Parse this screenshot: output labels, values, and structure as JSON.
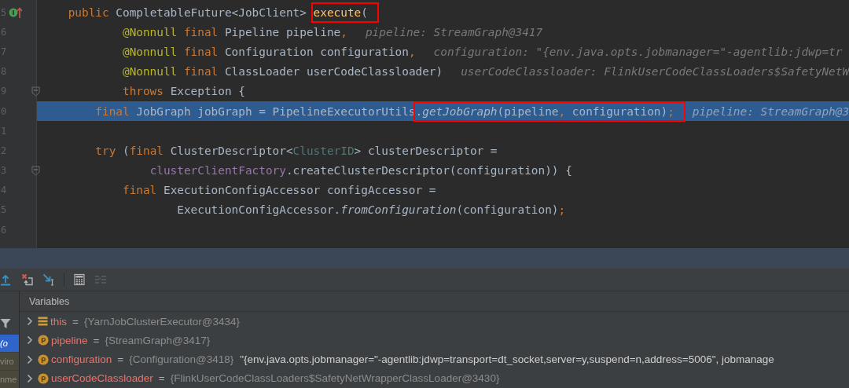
{
  "editor": {
    "lines": [
      {
        "number": "5",
        "override": true,
        "fold": false,
        "selected": false,
        "tokens": [
          {
            "kind": "keyword",
            "text": "    public"
          },
          {
            "kind": "plain",
            "text": " CompletableFuture<JobClient> "
          },
          {
            "kind": "frame",
            "tokens": [
              {
                "kind": "declaration",
                "text": "execute"
              },
              {
                "kind": "plain",
                "text": "("
              }
            ]
          }
        ]
      },
      {
        "number": "6",
        "override": false,
        "fold": false,
        "selected": false,
        "tokens": [
          {
            "kind": "annotation",
            "text": "            @Nonnull"
          },
          {
            "kind": "keyword",
            "text": " final"
          },
          {
            "kind": "plain",
            "text": " Pipeline pipeline"
          },
          {
            "kind": "punct",
            "text": ","
          }
        ],
        "hint": "pipeline: StreamGraph@3417"
      },
      {
        "number": "7",
        "override": false,
        "fold": false,
        "selected": false,
        "tokens": [
          {
            "kind": "annotation",
            "text": "            @Nonnull"
          },
          {
            "kind": "keyword",
            "text": " final"
          },
          {
            "kind": "plain",
            "text": " Configuration configuration"
          },
          {
            "kind": "punct",
            "text": ","
          }
        ],
        "hint": "configuration: \"{env.java.opts.jobmanager=\"-agentlib:jdwp=tr"
      },
      {
        "number": "8",
        "override": false,
        "fold": false,
        "selected": false,
        "tokens": [
          {
            "kind": "annotation",
            "text": "            @Nonnull"
          },
          {
            "kind": "keyword",
            "text": " final"
          },
          {
            "kind": "plain",
            "text": " ClassLoader userCodeClassloader)"
          }
        ],
        "hint": "userCodeClassloader: FlinkUserCodeClassLoaders$SafetyNetW"
      },
      {
        "number": "9",
        "override": false,
        "fold": true,
        "selected": false,
        "tokens": [
          {
            "kind": "keyword",
            "text": "            throws"
          },
          {
            "kind": "plain",
            "text": " Exception {"
          }
        ]
      },
      {
        "number": "0",
        "override": false,
        "fold": false,
        "selected": true,
        "tokens": [
          {
            "kind": "keyword",
            "text": "        final"
          },
          {
            "kind": "plain",
            "text": " JobGraph jobGraph = PipelineExecutorUtils"
          },
          {
            "kind": "frame",
            "tokens": [
              {
                "kind": "plain",
                "text": "."
              },
              {
                "kind": "static",
                "text": "getJobGraph"
              },
              {
                "kind": "plain",
                "text": "(pipeline"
              },
              {
                "kind": "punct",
                "text": ","
              },
              {
                "kind": "plain",
                "text": " configuration)"
              },
              {
                "kind": "punct",
                "text": ";"
              }
            ]
          }
        ],
        "hint": "pipeline: StreamGraph@3"
      },
      {
        "number": "1",
        "override": false,
        "fold": false,
        "selected": false
      },
      {
        "number": "2",
        "override": false,
        "fold": false,
        "selected": false,
        "tokens": [
          {
            "kind": "keyword",
            "text": "        try"
          },
          {
            "kind": "plain",
            "text": " ("
          },
          {
            "kind": "keyword",
            "text": "final"
          },
          {
            "kind": "plain",
            "text": " ClusterDescriptor<"
          },
          {
            "kind": "typeparam",
            "text": "ClusterID"
          },
          {
            "kind": "plain",
            "text": "> clusterDescriptor ="
          }
        ]
      },
      {
        "number": "3",
        "override": false,
        "fold": true,
        "selected": false,
        "tokens": [
          {
            "kind": "field",
            "text": "                clusterClientFactory"
          },
          {
            "kind": "plain",
            "text": ".createClusterDescriptor(configuration)) {"
          }
        ]
      },
      {
        "number": "4",
        "override": false,
        "fold": false,
        "selected": false,
        "tokens": [
          {
            "kind": "keyword",
            "text": "            final"
          },
          {
            "kind": "plain",
            "text": " ExecutionConfigAccessor configAccessor ="
          }
        ]
      },
      {
        "number": "5",
        "override": false,
        "fold": false,
        "selected": false,
        "tokens": [
          {
            "kind": "plain",
            "text": "                    ExecutionConfigAccessor."
          },
          {
            "kind": "static",
            "text": "fromConfiguration"
          },
          {
            "kind": "plain",
            "text": "(configuration)"
          },
          {
            "kind": "punct",
            "text": ";"
          }
        ]
      },
      {
        "number": "6",
        "override": false,
        "fold": false,
        "selected": false
      }
    ]
  },
  "debugger": {
    "toolbar": [
      {
        "buttons": [
          {
            "kind": "step-out",
            "disabled": false
          },
          {
            "kind": "drop-frame",
            "disabled": false
          },
          {
            "kind": "run-to-cursor",
            "disabled": false
          }
        ]
      },
      {
        "buttons": [
          {
            "kind": "evaluate",
            "disabled": false
          },
          {
            "kind": "trace",
            "disabled": true
          }
        ]
      }
    ],
    "frames": [
      {
        "text": "(o",
        "selected": true
      },
      {
        "text": "viro",
        "selected": false
      },
      {
        "text": "nme",
        "selected": false
      }
    ],
    "variables_title": "Variables",
    "variables": [
      {
        "kind": "object",
        "name": "this",
        "operator": "=",
        "value": "{YarnJobClusterExecutor@3434}"
      },
      {
        "kind": "parameter",
        "name": "pipeline",
        "operator": "=",
        "value": "{StreamGraph@3417}"
      },
      {
        "kind": "parameter",
        "name": "configuration",
        "operator": "=",
        "value": "{Configuration@3418}",
        "string": "\"{env.java.opts.jobmanager=\"-agentlib:jdwp=transport=dt_socket,server=y,suspend=n,address=5006\", jobmanage"
      },
      {
        "kind": "parameter",
        "name": "userCodeClassloader",
        "operator": "=",
        "value": "{FlinkUserCodeClassLoaders$SafetyNetWrapperClassLoader@3430}"
      }
    ]
  }
}
